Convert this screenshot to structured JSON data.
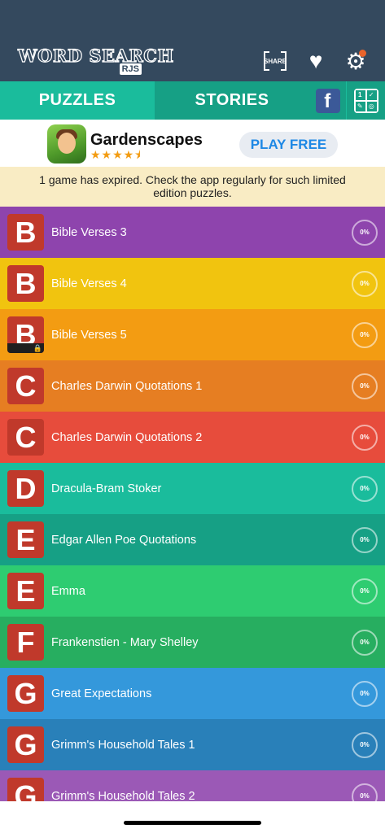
{
  "app": {
    "logo_text": "WORD SEARCH",
    "logo_sub": "RJS"
  },
  "header": {
    "share_label": "SHARE",
    "share_icon": "share-icon",
    "favorite_icon": "heart-icon",
    "settings_icon": "gear-icon",
    "notification_dot_color": "#e8642c"
  },
  "tabs": {
    "puzzles": "PUZZLES",
    "stories": "STORIES",
    "facebook_glyph": "f",
    "grid_icon": "apps-grid-icon"
  },
  "ad": {
    "title": "Gardenscapes",
    "stars": "★★★★⯨",
    "cta": "PLAY FREE"
  },
  "notice": {
    "text": "1 game has expired. Check the app regularly for such limited edition puzzles."
  },
  "puzzles": [
    {
      "letter": "B",
      "title": "Bible Verses 3",
      "progress": "0%",
      "color": "#8e44ad",
      "locked": false
    },
    {
      "letter": "B",
      "title": "Bible Verses 4",
      "progress": "0%",
      "color": "#f1c40f",
      "locked": false
    },
    {
      "letter": "B",
      "title": "Bible Verses 5",
      "progress": "0%",
      "color": "#f39c12",
      "locked": true
    },
    {
      "letter": "C",
      "title": "Charles Darwin Quotations 1",
      "progress": "0%",
      "color": "#e67e22",
      "locked": false
    },
    {
      "letter": "C",
      "title": "Charles Darwin Quotations 2",
      "progress": "0%",
      "color": "#e74c3c",
      "locked": false
    },
    {
      "letter": "D",
      "title": "Dracula-Bram Stoker",
      "progress": "0%",
      "color": "#1abc9c",
      "locked": false
    },
    {
      "letter": "E",
      "title": "Edgar Allen Poe Quotations",
      "progress": "0%",
      "color": "#16a085",
      "locked": false
    },
    {
      "letter": "E",
      "title": "Emma",
      "progress": "0%",
      "color": "#2ecc71",
      "locked": false
    },
    {
      "letter": "F",
      "title": "Frankenstien - Mary Shelley",
      "progress": "0%",
      "color": "#27ae60",
      "locked": false
    },
    {
      "letter": "G",
      "title": "Great Expectations",
      "progress": "0%",
      "color": "#3498db",
      "locked": false
    },
    {
      "letter": "G",
      "title": "Grimm's Household Tales 1",
      "progress": "0%",
      "color": "#2980b9",
      "locked": false
    },
    {
      "letter": "G",
      "title": "Grimm's Household Tales 2",
      "progress": "0%",
      "color": "#9b59b6",
      "locked": false
    }
  ]
}
